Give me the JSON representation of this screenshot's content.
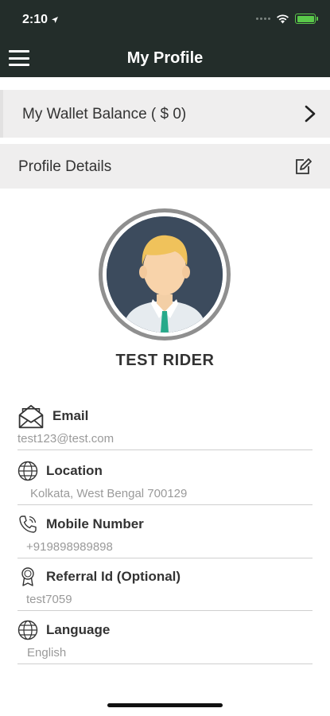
{
  "status_bar": {
    "time": "2:10"
  },
  "header": {
    "title": "My Profile"
  },
  "wallet": {
    "label": "My Wallet Balance ( $ 0)"
  },
  "profile_details": {
    "label": "Profile Details"
  },
  "user": {
    "name": "TEST RIDER"
  },
  "fields": [
    {
      "label": "Email",
      "value": "test123@test.com",
      "icon": "envelope-icon"
    },
    {
      "label": "Location",
      "value": "Kolkata, West Bengal 700129",
      "icon": "globe-icon"
    },
    {
      "label": "Mobile Number",
      "value": "+919898989898",
      "icon": "phone-icon"
    },
    {
      "label": "Referral Id (Optional)",
      "value": "test7059",
      "icon": "award-icon"
    },
    {
      "label": "Language",
      "value": "English",
      "icon": "globe-icon"
    }
  ],
  "colors": {
    "header_bg": "#232d2a",
    "row_bg": "#efeeee",
    "battery": "#5ac84a",
    "avatar_bg": "#3c4b5d"
  }
}
